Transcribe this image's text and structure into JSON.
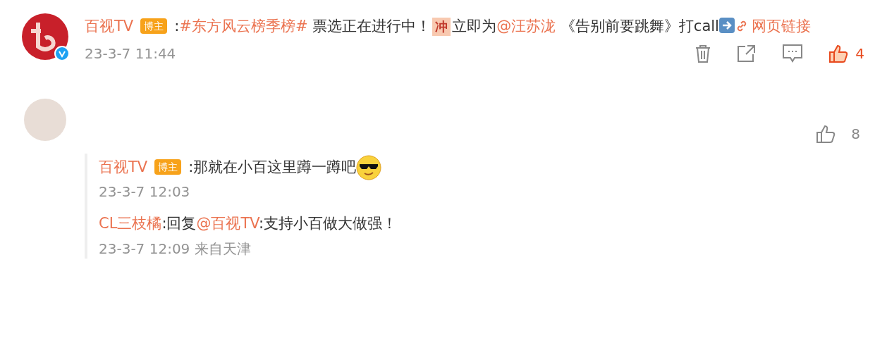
{
  "post": {
    "author": "百视TV",
    "badge": "博主",
    "verified": true,
    "segments": [
      {
        "kind": "text",
        "text": ":"
      },
      {
        "kind": "link",
        "text": "#东方风云榜季榜#"
      },
      {
        "kind": "text",
        "text": " 票选正在进行中！"
      },
      {
        "kind": "emoji",
        "text": "冲"
      },
      {
        "kind": "text",
        "text": "立即为"
      },
      {
        "kind": "link",
        "text": "@汪苏泷"
      },
      {
        "kind": "text",
        "text": " 《告别前要跳舞》打call"
      },
      {
        "kind": "arrow"
      },
      {
        "kind": "weblink",
        "text": "网页链接"
      }
    ],
    "time": "23-3-7 11:44",
    "likes": "4",
    "liked": true
  },
  "second_comment": {
    "likes": "8",
    "liked": false
  },
  "replies": [
    {
      "author": "百视TV",
      "badge": "博主",
      "segments": [
        {
          "kind": "text",
          "text": ":那就在小百这里蹲一蹲吧"
        },
        {
          "kind": "cool"
        }
      ],
      "time": "23-3-7 12:03"
    },
    {
      "author": "CL三枝橘",
      "segments": [
        {
          "kind": "text",
          "text": ":回复"
        },
        {
          "kind": "link",
          "text": "@百视TV"
        },
        {
          "kind": "text",
          "text": ":支持小百做大做强！"
        }
      ],
      "time": "23-3-7 12:09 来自天津"
    }
  ]
}
